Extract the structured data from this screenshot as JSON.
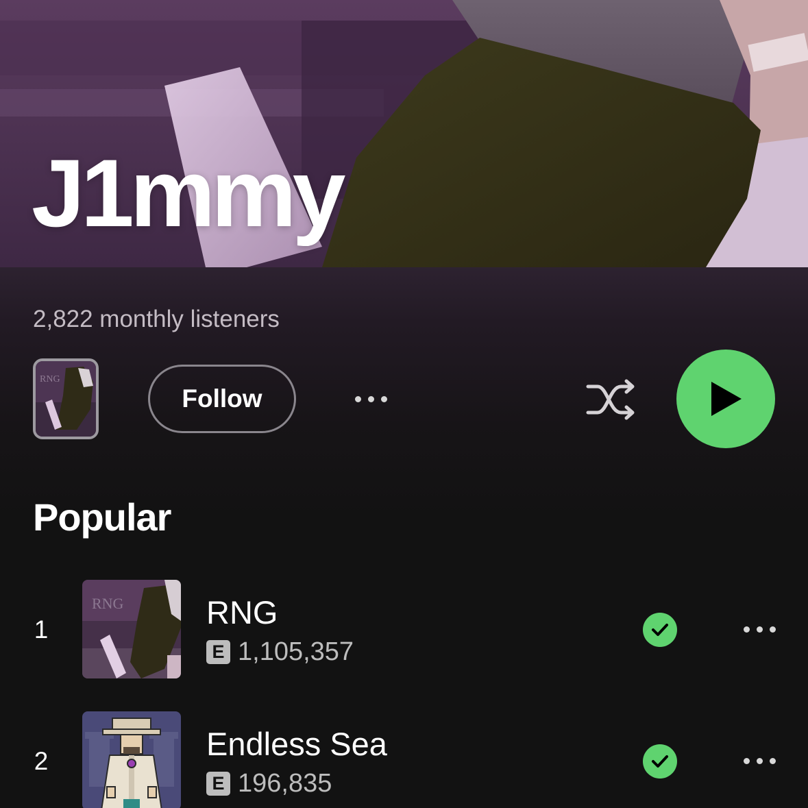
{
  "artist": {
    "name": "J1mmy",
    "monthly_listeners": "2,822 monthly listeners"
  },
  "actions": {
    "follow_label": "Follow",
    "cover_thumb_text": "RNG"
  },
  "popular": {
    "title": "Popular",
    "tracks": [
      {
        "rank": "1",
        "title": "RNG",
        "explicit": "E",
        "plays": "1,105,357",
        "art_text": "RNG",
        "saved": true
      },
      {
        "rank": "2",
        "title": "Endless Sea",
        "explicit": "E",
        "plays": "196,835",
        "saved": true
      }
    ]
  },
  "colors": {
    "accent_green": "#5fd36f",
    "background": "#121212",
    "hero_purple": "#4a2e4f",
    "subtext": "#bdbdbd"
  },
  "icons": {
    "shuffle": "shuffle-icon",
    "play": "play-icon",
    "more": "more-options-icon",
    "saved": "check-circle-icon"
  }
}
